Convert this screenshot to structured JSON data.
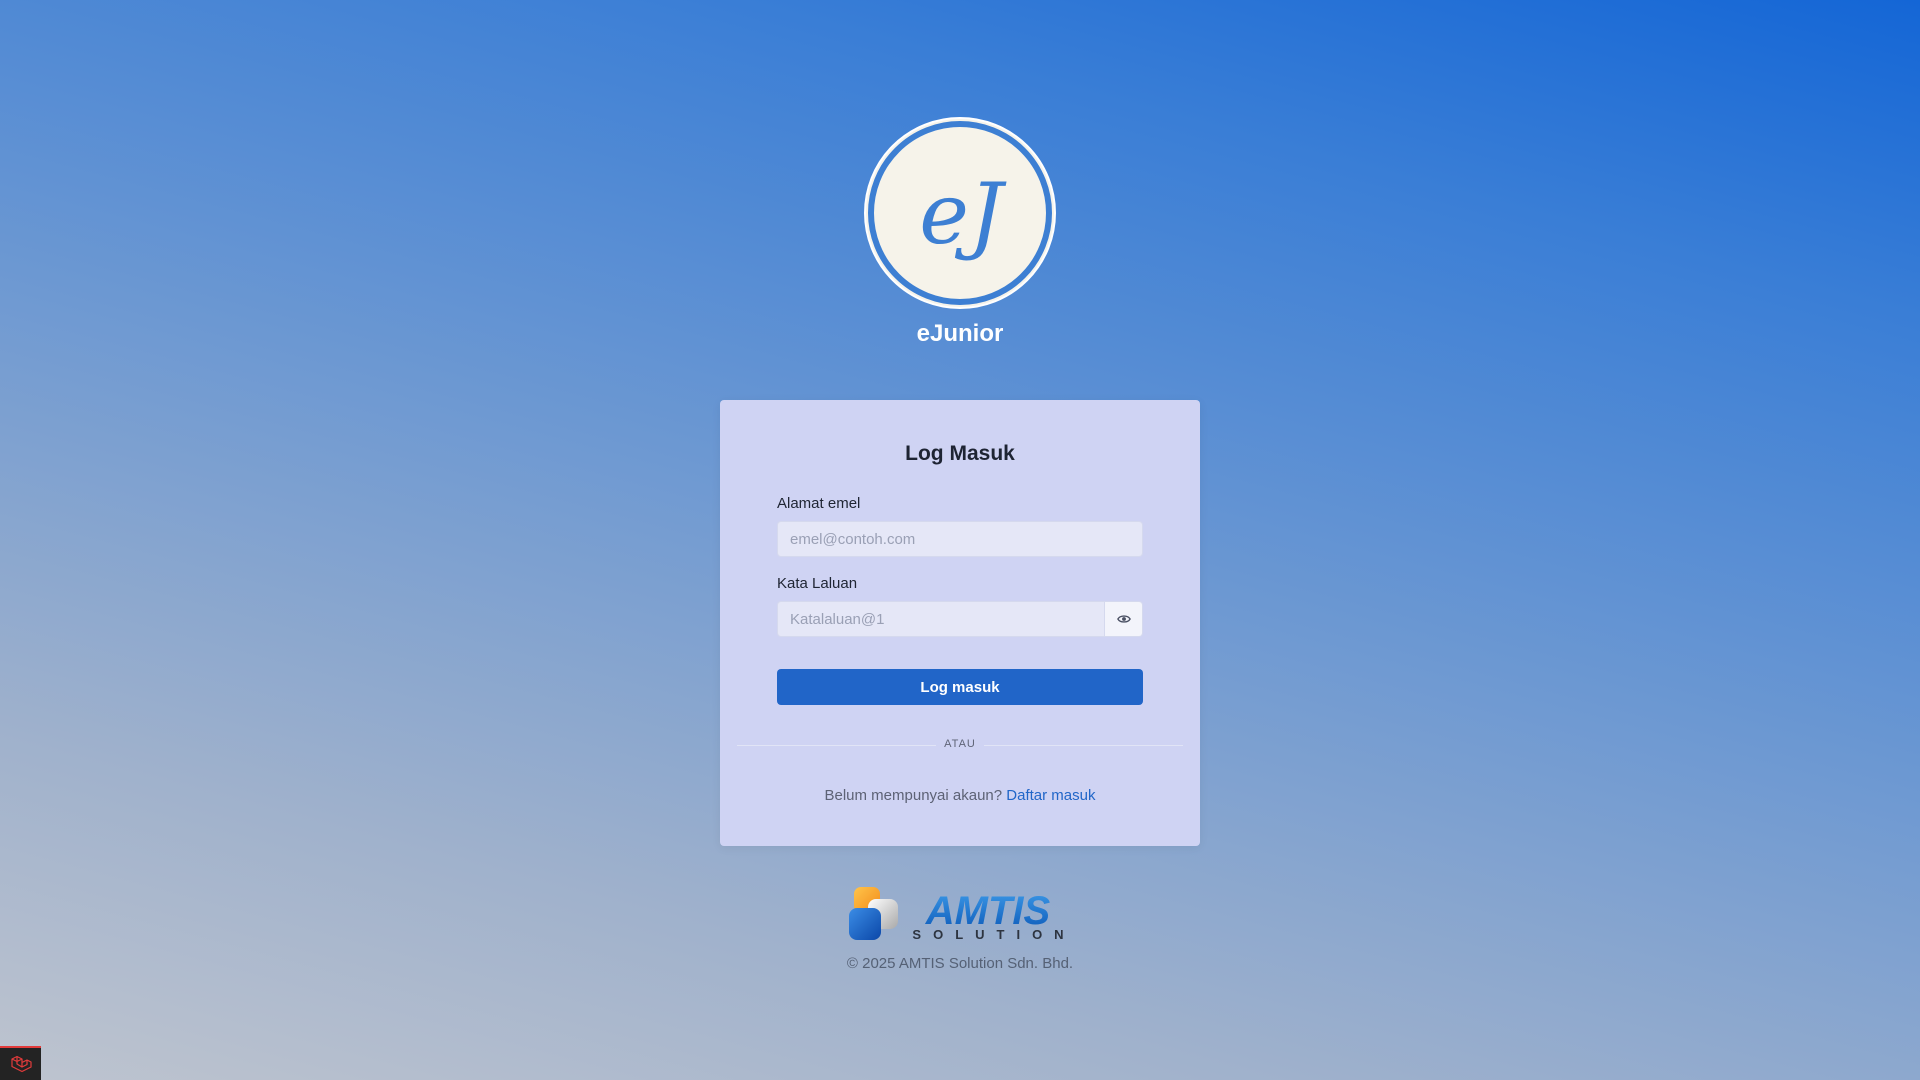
{
  "app": {
    "name": "eJunior",
    "logo_text": "eJ"
  },
  "login": {
    "title": "Log Masuk",
    "email_label": "Alamat emel",
    "email_placeholder": "emel@contoh.com",
    "email_value": "",
    "password_label": "Kata Laluan",
    "password_placeholder": "Katalaluan@1",
    "password_value": "",
    "show_password_icon": "eye-icon",
    "submit_label": "Log masuk",
    "divider_text": "ATAU",
    "signup_prompt": "Belum mempunyai akaun?",
    "signup_link": "Daftar masuk"
  },
  "footer": {
    "company_logo_text": "AMTIS",
    "company_logo_subtext": "SOLUTION",
    "copyright": "© 2025 AMTIS Solution Sdn. Bhd."
  },
  "debug_widget": {
    "icon": "laravel-icon"
  },
  "colors": {
    "primary": "#2165c8",
    "logo_ring": "#3d7fd3",
    "logo_fill": "#f6f3ea",
    "card_bg": "#cfd3f3"
  }
}
